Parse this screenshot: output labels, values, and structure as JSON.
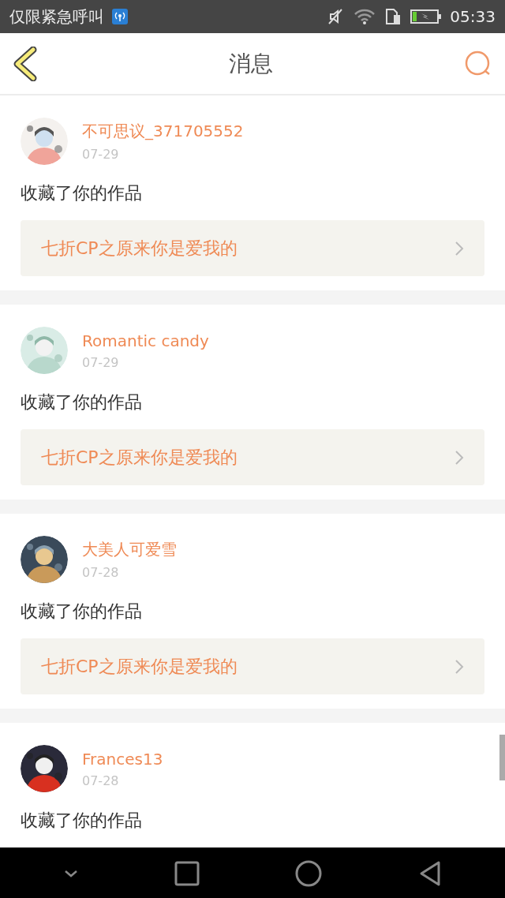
{
  "status_bar": {
    "carrier": "仅限紧急呼叫",
    "time": "05:33"
  },
  "header": {
    "title": "消息"
  },
  "messages": [
    {
      "user": "不可思议_371705552",
      "date": "07-29",
      "action": "收藏了你的作品",
      "work": "七折CP之原来你是爱我的"
    },
    {
      "user": "Romantic candy",
      "date": "07-29",
      "action": "收藏了你的作品",
      "work": "七折CP之原来你是爱我的"
    },
    {
      "user": "大美人可爱雪",
      "date": "07-28",
      "action": "收藏了你的作品",
      "work": "七折CP之原来你是爱我的"
    },
    {
      "user": "Frances13",
      "date": "07-28",
      "action": "收藏了你的作品"
    }
  ]
}
